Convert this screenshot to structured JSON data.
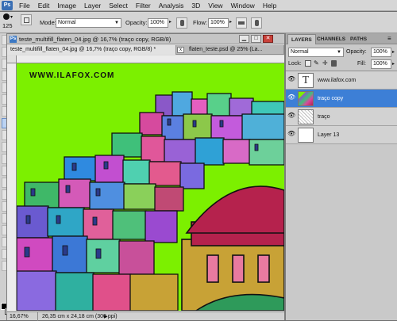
{
  "menu": {
    "logo": "Ps",
    "items": [
      "File",
      "Edit",
      "Image",
      "Layer",
      "Select",
      "Filter",
      "Analysis",
      "3D",
      "View",
      "Window",
      "Help"
    ]
  },
  "options": {
    "brush_size": "125",
    "mode_label": "Mode:",
    "mode_value": "Normal",
    "opacity_label": "Opacity:",
    "opacity_value": "100%",
    "flow_label": "Flow:",
    "flow_value": "100%"
  },
  "document": {
    "window_title": "teste_multifill_flaten_04.jpg @ 16,7% (traço copy, RGB/8)",
    "tabs": [
      "teste_multifill_flaten_04.jpg @ 16,7% (traço copy, RGB/8) *",
      "flaten_teste.psd @ 25% (La..."
    ],
    "watermark": "WWW.ILAFOX.COM",
    "zoom": "16,67%",
    "doc_info": "26,35 cm x 24,18 cm (300 ppi)"
  },
  "panel": {
    "tabs": [
      "LAYERS",
      "CHANNELS",
      "PATHS"
    ],
    "blend_mode": "Normal",
    "opacity_label": "Opacity:",
    "opacity_value": "100%",
    "lock_label": "Lock:",
    "fill_label": "Fill:",
    "fill_value": "100%",
    "layers": [
      {
        "name": "www.ilafox.com",
        "type": "text",
        "selected": false
      },
      {
        "name": "traço copy",
        "type": "image",
        "selected": true
      },
      {
        "name": "traço",
        "type": "lineart",
        "selected": false
      },
      {
        "name": "Layer 13",
        "type": "blank",
        "selected": false
      }
    ]
  },
  "colors": {
    "sky": "#7cf000",
    "selection": "#3d7fd6",
    "dome": "#b5224d"
  }
}
